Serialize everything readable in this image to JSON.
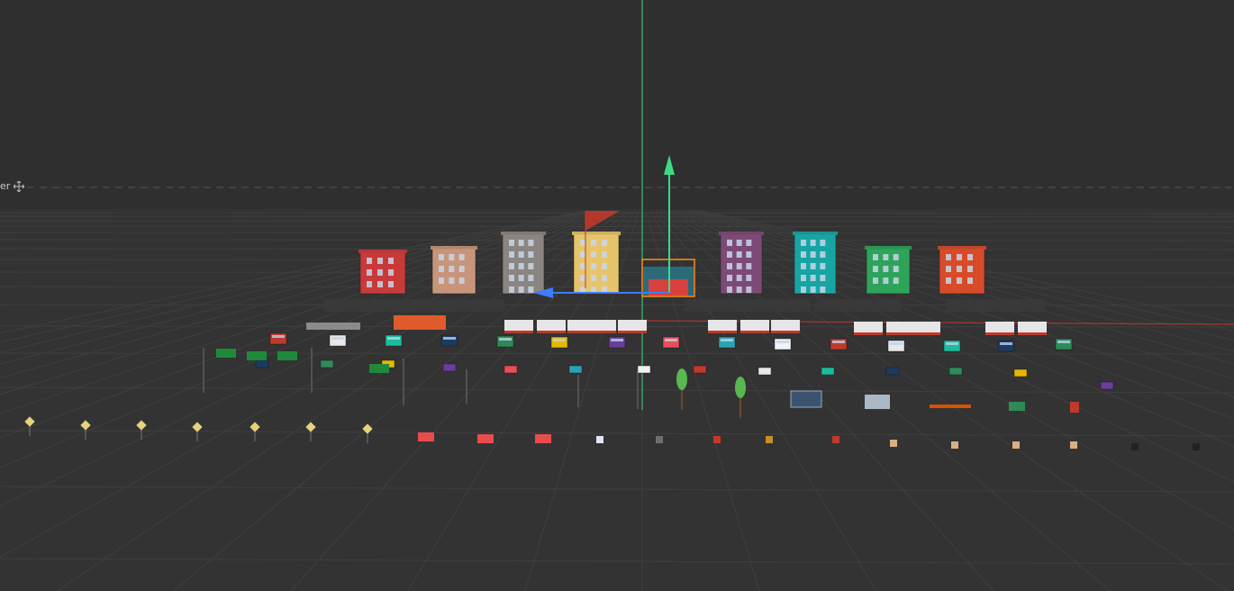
{
  "viewport": {
    "corner_text": "er",
    "corner_icon": "move-icon",
    "background_color": "#2f2f2f",
    "ground_color": "#333333",
    "grid_color": "#3f3f3f",
    "y_axis_color": "#3ddc84",
    "x_axis_color": "#c0392b",
    "z_axis_color": "#3d7cff",
    "selection_color": "#ff8c1a"
  },
  "scene": {
    "building_colors": [
      "#c83a3a",
      "#c8957a",
      "#8a8580",
      "#e6c46a",
      "#7d4a77",
      "#17a5a3",
      "#2ea35a",
      "#d84b2a"
    ],
    "vehicle_colors": [
      "#c0392b",
      "#e8e8e8",
      "#1abc9c",
      "#1f3a5f",
      "#2e8b57",
      "#e6b800",
      "#6a3d9a",
      "#e84d5b",
      "#2aa3b5",
      "#f2f2f2"
    ],
    "tree_color": "#57b84f",
    "sign_color": "#f2f2f2"
  }
}
